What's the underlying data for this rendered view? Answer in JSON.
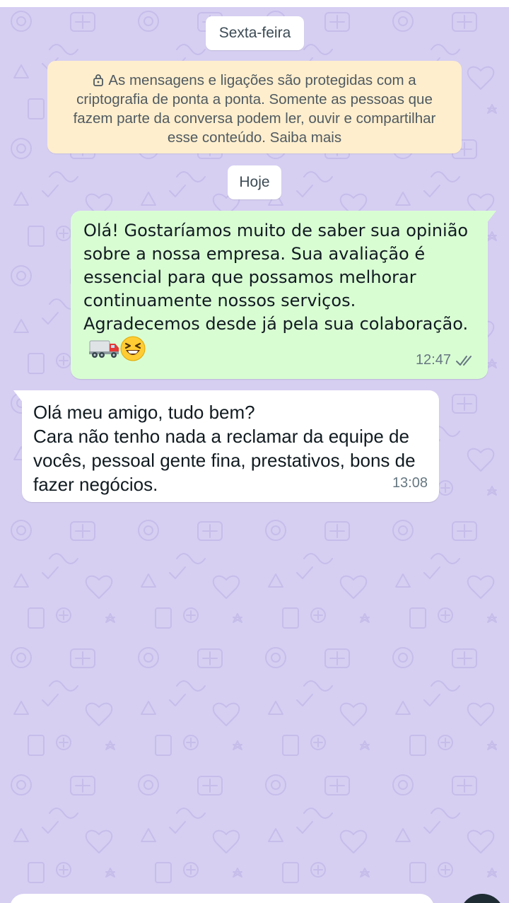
{
  "chat": {
    "date_chips": {
      "first": "Sexta-feira",
      "second": "Hoje"
    },
    "encryption_notice": {
      "icon": "lock-icon",
      "text": "As mensagens e ligações são protegidas com a criptografia de ponta a ponta. Somente as pessoas que fazem parte da conversa podem ler, ouvir e compartilhar esse conteúdo. Saiba mais"
    },
    "messages": [
      {
        "direction": "outgoing",
        "text": "Olá! Gostaríamos muito de saber sua opinião sobre a nossa empresa. Sua avaliação é essencial para que possamos melhorar continuamente nossos serviços. Agradecemos desde já pela sua colaboração.",
        "emojis": [
          "truck-emoji",
          "laughing-face-emoji"
        ],
        "time": "12:47",
        "status_icon": "double-check-icon"
      },
      {
        "direction": "incoming",
        "text": "Olá meu amigo, tudo bem?\nCara não tenho nada a reclamar da equipe de vocês, pessoal gente fina, prestativos, bons de fazer negócios.",
        "time": "13:08"
      }
    ]
  },
  "colors": {
    "wallpaper": "#d6cff2",
    "outgoing_bubble": "#d9fdd3",
    "incoming_bubble": "#ffffff",
    "notice": "#ffeecd",
    "timestamp": "#667781"
  }
}
